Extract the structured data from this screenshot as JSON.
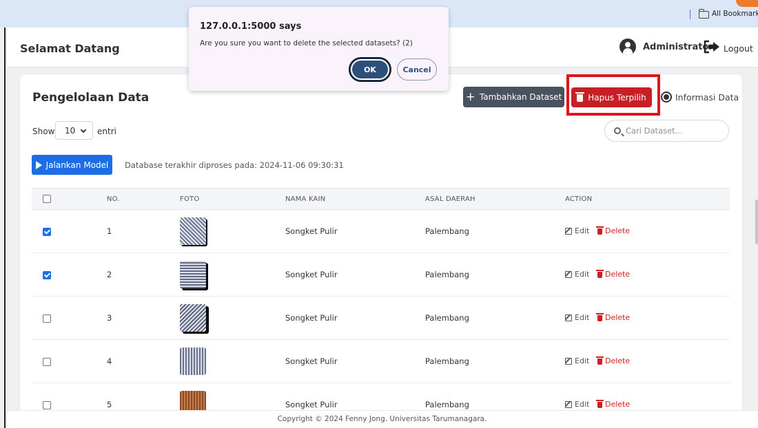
{
  "browser": {
    "bookmarks_label": "All Bookmarks"
  },
  "topbar": {
    "welcome": "Selamat Datang",
    "user_name": "Administrator",
    "logout_label": "Logout"
  },
  "page": {
    "title": "Pengelolaan Data",
    "add_button_label": "Tambahkan Dataset",
    "delete_selected_label": "Hapus Terpilih",
    "info_label": "Informasi Data",
    "show_label": "Show",
    "entries_value": "10",
    "entries_label": "entri",
    "search_placeholder": "Cari Dataset...",
    "run_model_label": "Jalankan Model",
    "db_status": "Database terakhir diproses pada: 2024-11-06 09:30:31"
  },
  "table": {
    "headers": [
      "NO.",
      "FOTO",
      "NAMA KAIN",
      "ASAL DAERAH",
      "ACTION"
    ],
    "edit_label": "Edit",
    "delete_label": "Delete",
    "rows": [
      {
        "no": "1",
        "nama": "Songket Pulir",
        "asal": "Palembang",
        "checked": true
      },
      {
        "no": "2",
        "nama": "Songket Pulir",
        "asal": "Palembang",
        "checked": true
      },
      {
        "no": "3",
        "nama": "Songket Pulir",
        "asal": "Palembang",
        "checked": false
      },
      {
        "no": "4",
        "nama": "Songket Pulir",
        "asal": "Palembang",
        "checked": false
      },
      {
        "no": "5",
        "nama": "Songket Pulir",
        "asal": "Palembang",
        "checked": false
      }
    ]
  },
  "footer": {
    "text": "Copyright © 2024 Fenny Jong. Universitas Tarumanagara."
  },
  "dialog": {
    "origin": "127.0.0.1:5000 says",
    "message": "Are you sure you want to delete the selected datasets? (2)",
    "ok_label": "OK",
    "cancel_label": "Cancel"
  },
  "colors": {
    "primary": "#1c6ee6",
    "danger": "#c71f26",
    "dark_button": "#48535e",
    "highlight": "#e0141a",
    "dialog_ok": "#2c4f7c"
  },
  "icons": [
    "folder-icon",
    "user-avatar-icon",
    "logout-icon",
    "plus-icon",
    "trash-icon",
    "info-icon",
    "search-icon",
    "play-icon",
    "edit-icon",
    "chevron-down-icon"
  ]
}
